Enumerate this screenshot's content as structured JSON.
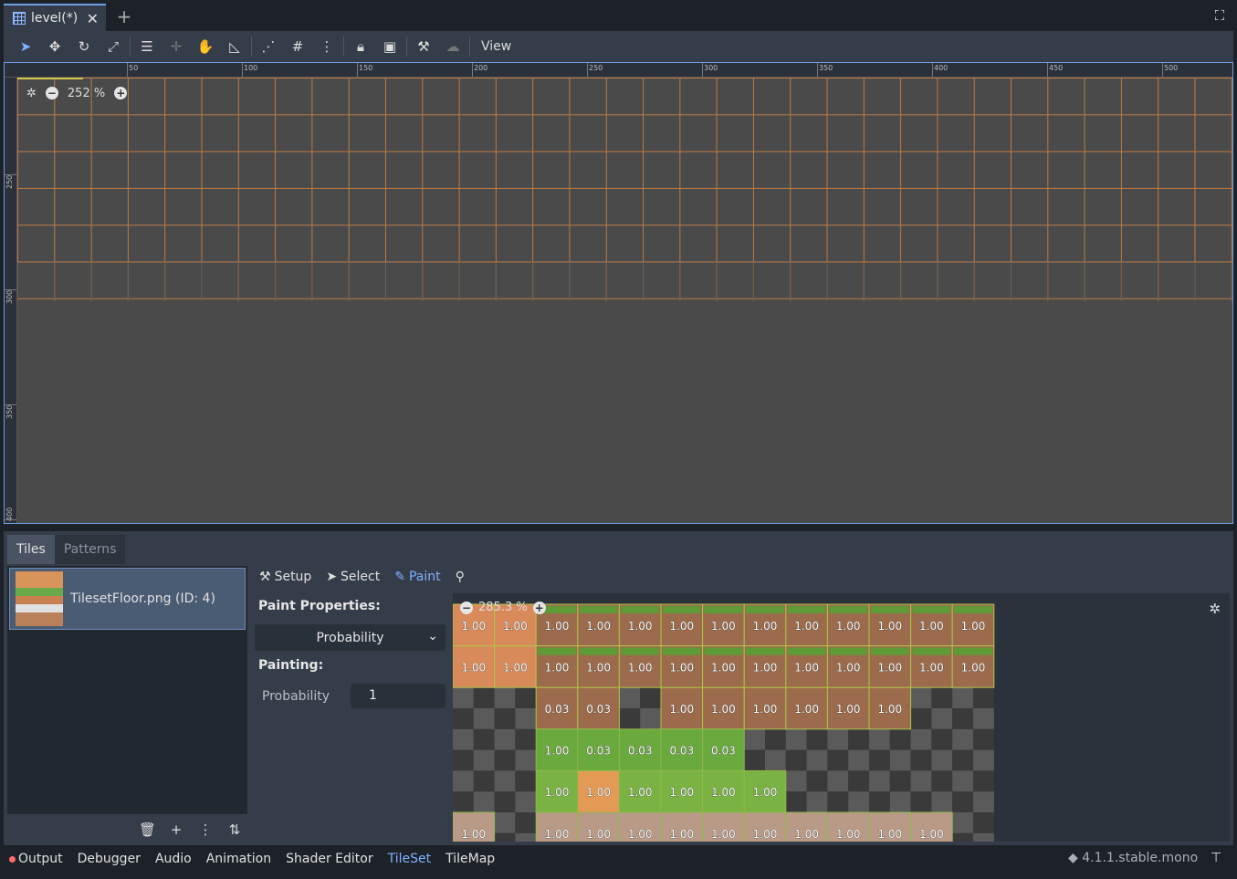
{
  "scene_tab": {
    "title": "level(*)"
  },
  "toolbar": {
    "view_label": "View"
  },
  "viewport": {
    "zoom": "252 %",
    "h_ruler": [
      "50",
      "100",
      "150",
      "200",
      "250",
      "300",
      "350",
      "400",
      "450",
      "500"
    ],
    "v_ruler": [
      "250",
      "300",
      "350",
      "400"
    ]
  },
  "bottom_tabs": [
    "Tiles",
    "Patterns"
  ],
  "tileset_item": "TilesetFloor.png (ID: 4)",
  "modes": {
    "setup": "Setup",
    "select": "Select",
    "paint": "Paint"
  },
  "paint": {
    "properties_label": "Paint Properties:",
    "selected_property": "Probability",
    "painting_label": "Painting:",
    "probability_label": "Probability",
    "probability_value": "1"
  },
  "atlas": {
    "zoom": "285.3 %",
    "rows": [
      [
        "1.00",
        "1.00",
        "1.00",
        "1.00",
        "1.00",
        "1.00",
        "1.00",
        "1.00",
        "1.00",
        "1.00",
        "1.00",
        "1.00",
        "1.00"
      ],
      [
        "1.00",
        "1.00",
        "1.00",
        "1.00",
        "1.00",
        "1.00",
        "1.00",
        "1.00",
        "1.00",
        "1.00",
        "1.00",
        "1.00",
        "1.00"
      ],
      [
        "",
        "",
        "0.03",
        "0.03",
        "",
        "1.00",
        "1.00",
        "1.00",
        "1.00",
        "1.00",
        "1.00",
        "",
        ""
      ],
      [
        "",
        "",
        "1.00",
        "0.03",
        "0.03",
        "0.03",
        "0.03",
        "",
        "",
        "",
        "",
        "",
        ""
      ],
      [
        "",
        "",
        "1.00",
        "1.00",
        "1.00",
        "1.00",
        "1.00",
        "1.00",
        "",
        "",
        "",
        "",
        ""
      ],
      [
        "1.00",
        "",
        "1.00",
        "1.00",
        "1.00",
        "1.00",
        "1.00",
        "1.00",
        "1.00",
        "1.00",
        "1.00",
        "1.00",
        ""
      ]
    ]
  },
  "status_bar": [
    "Output",
    "Debugger",
    "Audio",
    "Animation",
    "Shader Editor",
    "TileSet",
    "TileMap"
  ],
  "version": "4.1.1.stable.mono"
}
